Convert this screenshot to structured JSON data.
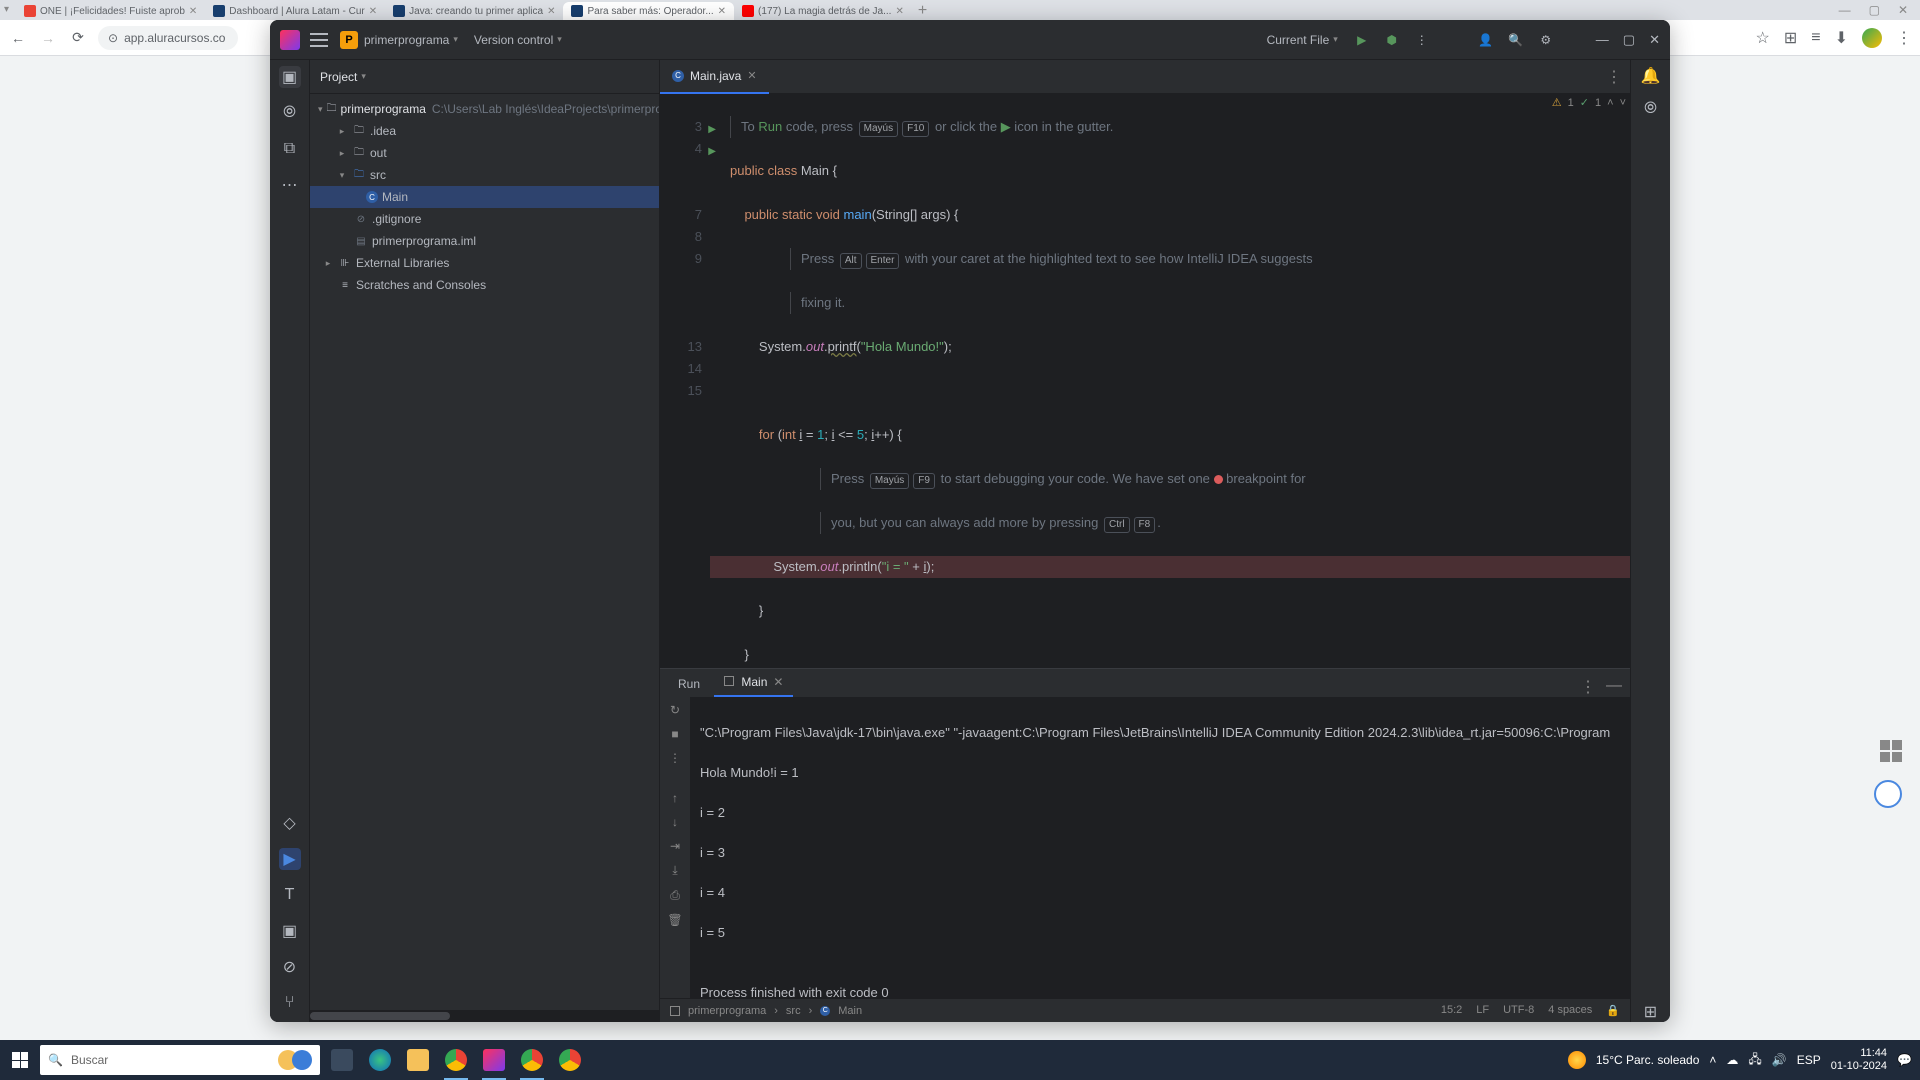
{
  "browser": {
    "tabs": [
      {
        "label": "ONE | ¡Felicidades! Fuiste aprob",
        "favicon": "#ea4335"
      },
      {
        "label": "Dashboard | Alura Latam - Cur",
        "favicon": "#2b2d30"
      },
      {
        "label": "Java: creando tu primer aplica",
        "favicon": "#2b2d30"
      },
      {
        "label": "Para saber más: Operador...",
        "favicon": "#2b2d30",
        "active": true
      },
      {
        "label": "(177) La magia detrás de Ja...",
        "favicon": "#ff0000"
      }
    ],
    "win_controls": {
      "min": "—",
      "max": "▢",
      "close": "✕"
    },
    "nav": {
      "back": "←",
      "forward": "→",
      "reload": "⟳"
    },
    "url": "app.aluracursos.co",
    "addr_icons": {
      "star": "☆",
      "ext": "⊞",
      "list": "≡",
      "dl": "⬇",
      "profile": "●",
      "more": "⋮"
    }
  },
  "ide": {
    "project_name": "primerprograma",
    "version_control": "Version control",
    "current_file": "Current File",
    "titlebar_icons": {
      "run": "▶",
      "debug": "🐞",
      "more": "⋮",
      "collab": "👥",
      "search": "🔍",
      "settings": "⚙",
      "min": "—",
      "max": "▢",
      "close": "✕"
    },
    "project_panel": {
      "title": "Project",
      "root": {
        "name": "primerprograma",
        "path": "C:\\Users\\Lab Inglés\\IdeaProjects\\primerprogram"
      },
      "tree": [
        {
          "indent": 1,
          "chev": "closed",
          "icon": "folder",
          "label": ".idea"
        },
        {
          "indent": 1,
          "chev": "closed",
          "icon": "folder",
          "label": "out"
        },
        {
          "indent": 1,
          "chev": "open",
          "icon": "folder-src",
          "label": "src"
        },
        {
          "indent": 2,
          "chev": "",
          "icon": "class",
          "label": "Main",
          "selected": true
        },
        {
          "indent": 1,
          "chev": "",
          "icon": "file",
          "label": ".gitignore"
        },
        {
          "indent": 1,
          "chev": "",
          "icon": "file",
          "label": "primerprograma.iml"
        },
        {
          "indent": 0,
          "chev": "closed",
          "icon": "folder",
          "label": "External Libraries"
        },
        {
          "indent": 0,
          "chev": "",
          "icon": "scratch",
          "label": "Scratches and Consoles"
        }
      ]
    },
    "editor": {
      "tab_name": "Main.java",
      "inspections": {
        "warn": "1",
        "ok": "1"
      },
      "hints": {
        "run_pre": "To ",
        "run_kw": "Run",
        "run_post": " code, press ",
        "run_k1": "Mayús",
        "run_k2": "F10",
        "run_or": " or click the ",
        "run_gutter": " icon in the gutter.",
        "alt_pre": "Press ",
        "alt_k1": "Alt",
        "alt_k2": "Enter",
        "alt_post": " with your caret at the highlighted text to see how IntelliJ IDEA suggests",
        "alt_line2": "fixing it.",
        "dbg_pre": "Press ",
        "dbg_k1": "Mayús",
        "dbg_k2": "F9",
        "dbg_mid": " to start debugging your code. We have set one ",
        "dbg_post": " breakpoint for",
        "dbg_line2_pre": "you, but you can always add more by pressing ",
        "dbg_k3": "Ctrl",
        "dbg_k4": "F8",
        "dbg_dot": "."
      },
      "lines": {
        "l3": {
          "n": "3"
        },
        "l4": {
          "n": "4"
        },
        "l7": {
          "n": "7"
        },
        "l8": {
          "n": "8"
        },
        "l9": {
          "n": "9"
        },
        "l13": {
          "n": "13"
        },
        "l14": {
          "n": "14"
        },
        "l15": {
          "n": "15"
        }
      },
      "code": {
        "l3": "public class Main {",
        "l4": "    public static void main(String[] args) {",
        "l7": "        System.out.printf(\"Hola Mundo!\");",
        "l9": "        for (int i = 1; i <= 5; i++) {",
        "l12": "            System.out.println(\"i = \" + i);",
        "l13": "        }",
        "l14": "    }",
        "l15": "}"
      }
    },
    "run": {
      "tool_label": "Run",
      "tab_label": "Main",
      "output": [
        "\"C:\\Program Files\\Java\\jdk-17\\bin\\java.exe\" \"-javaagent:C:\\Program Files\\JetBrains\\IntelliJ IDEA Community Edition 2024.2.3\\lib\\idea_rt.jar=50096:C:\\Program",
        "Hola Mundo!i = 1",
        "i = 2",
        "i = 3",
        "i = 4",
        "i = 5",
        "",
        "Process finished with exit code 0"
      ]
    },
    "statusbar": {
      "crumbs": [
        "primerprograma",
        "src",
        "Main"
      ],
      "pos": "15:2",
      "enc": "LF",
      "charset": "UTF-8",
      "indent": "4 spaces"
    }
  },
  "taskbar": {
    "search_placeholder": "Buscar",
    "weather": "15°C  Parc. soleado",
    "lang": "ESP",
    "time": "11:44",
    "date": "01-10-2024"
  }
}
